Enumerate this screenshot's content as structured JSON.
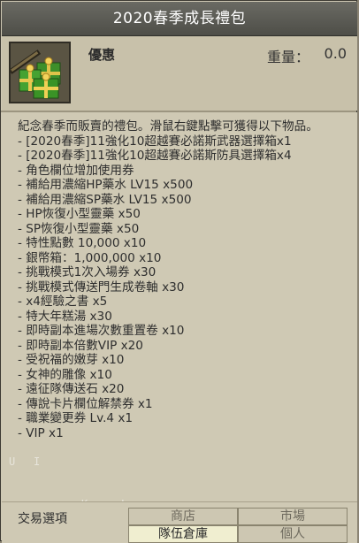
{
  "title": "2020春季成長禮包",
  "header": {
    "category": "優惠",
    "weight_label": "重量：",
    "weight_value": "0.0",
    "icon": "gift-boxes-icon"
  },
  "description": {
    "intro": "紀念春季而販賣的禮包。滑鼠右鍵點擊可獲得以下物品。",
    "items": [
      "- [2020春季]11強化10超越賽必諾斯武器選擇箱x1",
      "- [2020春季]11強化10超越賽必諾斯防具選擇箱x4",
      "- 角色欄位增加使用券",
      "- 補給用濃縮HP藥水 LV15 x500",
      "- 補給用濃縮SP藥水 LV15 x500",
      "- HP恢復小型靈藥 x50",
      "- SP恢復小型靈藥 x50",
      "- 特性點數 10,000 x10",
      "- 銀幣箱：1,000,000 x10",
      "- 挑戰模式1次入場券 x30",
      "- 挑戰模式傳送門生成卷軸 x30",
      "- x4經驗之書 x5",
      "- 特大年糕湯 x30",
      "- 即時副本進場次數重置卷 x10",
      "- 即時副本倍數VIP x20",
      "- 受祝福的嫩芽 x10",
      "- 女神的雕像 x10",
      "- 遠征隊傳送石 x20",
      "- 傳說卡片欄位解禁券 x1",
      "- 職業變更券 Lv.4 x1",
      "- VIP x1"
    ]
  },
  "footer": {
    "trade_label": "交易選項",
    "options": [
      {
        "label": "商店",
        "enabled": false
      },
      {
        "label": "市場",
        "enabled": false
      },
      {
        "label": "隊伍倉庫",
        "enabled": true
      },
      {
        "label": "個人",
        "enabled": false
      }
    ]
  },
  "faint_letters": [
    "U",
    "I",
    "K",
    "L"
  ],
  "colors": {
    "title_bg": "#5b5b55",
    "panel_bg": "#cfc9b4",
    "text": "#2e2e2e",
    "enabled_cell": "#f0eed0",
    "disabled_cell": "#cdc7b2"
  }
}
